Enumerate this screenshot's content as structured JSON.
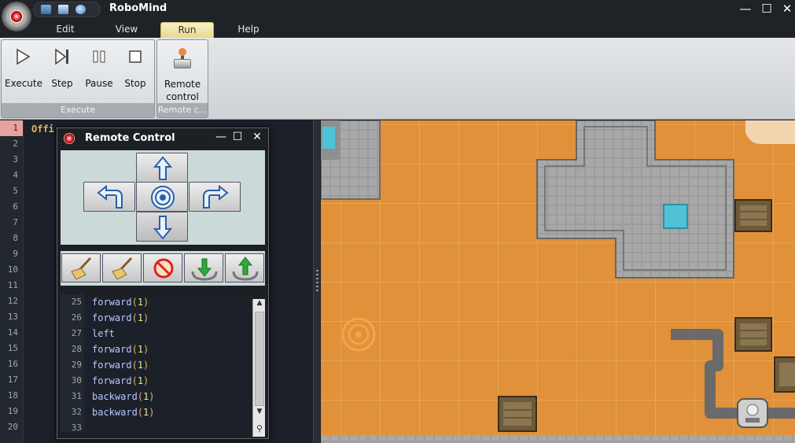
{
  "app": {
    "title": "RoboMind"
  },
  "window_controls": {
    "minimize": "—",
    "maximize": "☐",
    "close": "✕"
  },
  "menu_tabs": [
    {
      "label": "Edit"
    },
    {
      "label": "View"
    },
    {
      "label": "Run"
    },
    {
      "label": "Help"
    }
  ],
  "ribbon": {
    "execute_group": {
      "label": "Execute",
      "buttons": [
        {
          "label": "Execute",
          "icon": "play-icon"
        },
        {
          "label": "Step",
          "icon": "step-icon"
        },
        {
          "label": "Pause",
          "icon": "pause-icon"
        },
        {
          "label": "Stop",
          "icon": "stop-icon"
        }
      ]
    },
    "remote_group": {
      "label": "Remote c...",
      "button_line1": "Remote",
      "button_line2": "control",
      "icon": "joystick-icon"
    }
  },
  "editor": {
    "line_numbers": [
      "1",
      "2",
      "3",
      "4",
      "5",
      "6",
      "7",
      "8",
      "9",
      "10",
      "11",
      "12",
      "13",
      "14",
      "15",
      "16",
      "17",
      "18",
      "19",
      "20"
    ],
    "active_line": "1",
    "first_line_text": "Offi"
  },
  "remote_control": {
    "title": "Remote Control",
    "pad_buttons": [
      "forward",
      "turn-left",
      "center",
      "turn-right",
      "backward"
    ],
    "tools": [
      "paint-white-brush",
      "paint-black-brush",
      "stop-painting",
      "pick-up",
      "put-down"
    ],
    "code_line_numbers": [
      "25",
      "26",
      "27",
      "28",
      "29",
      "30",
      "31",
      "32",
      "33"
    ],
    "code_lines": [
      {
        "cmd": "forward",
        "arg": "1"
      },
      {
        "cmd": "forward",
        "arg": "1"
      },
      {
        "cmd": "left",
        "arg": ""
      },
      {
        "cmd": "forward",
        "arg": "1"
      },
      {
        "cmd": "forward",
        "arg": "1"
      },
      {
        "cmd": "forward",
        "arg": "1"
      },
      {
        "cmd": "backward",
        "arg": "1"
      },
      {
        "cmd": "backward",
        "arg": "1"
      }
    ]
  },
  "colors": {
    "sand": "#e0913a",
    "wall": "#9a9a9a",
    "water": "#4fc3d6",
    "box": "#6e5a3a",
    "painted_line": "#6a6a6a"
  }
}
